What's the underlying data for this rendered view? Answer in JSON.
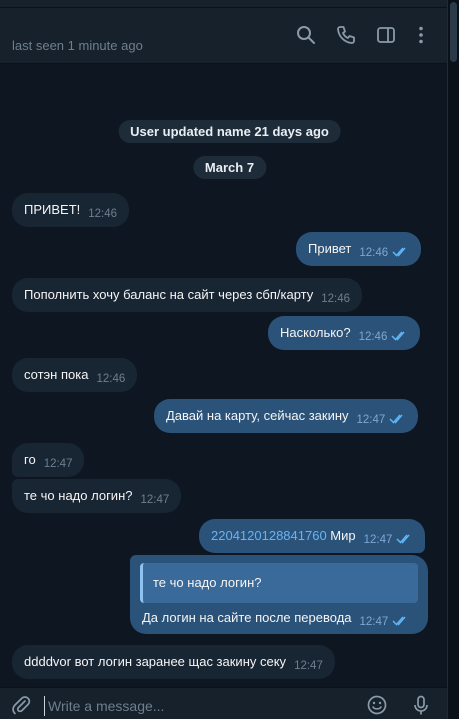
{
  "header": {
    "status": "last seen 1 minute ago",
    "icons": [
      "search-icon",
      "phone-icon",
      "sidebar-icon",
      "more-icon"
    ]
  },
  "service": {
    "name_update": "User updated name 21 days ago",
    "date": "March 7"
  },
  "messages": [
    {
      "dir": "in",
      "text": "ПРИВЕТ!",
      "time": "12:46"
    },
    {
      "dir": "out",
      "text": "Привет",
      "time": "12:46"
    },
    {
      "dir": "in",
      "text": "Пополнить хочу баланс на сайт через сбп/карту",
      "time": "12:46"
    },
    {
      "dir": "out",
      "text": "Насколько?",
      "time": "12:46"
    },
    {
      "dir": "in",
      "text": "сотэн пока",
      "time": "12:46"
    },
    {
      "dir": "out",
      "text": "Давай на карту, сейчас закину",
      "time": "12:47"
    },
    {
      "dir": "in",
      "text": "го",
      "time": "12:47"
    },
    {
      "dir": "in",
      "text": "те чо надо логин?",
      "time": "12:47"
    },
    {
      "dir": "out",
      "link": "2204120128841760",
      "text": " Мир",
      "time": "12:47"
    },
    {
      "dir": "out",
      "quote": "те чо надо логин?",
      "text": "Да логин на сайте после перевода",
      "time": "12:47"
    },
    {
      "dir": "in",
      "text": "ddddvor вот логин заранее щас закину секу",
      "time": "12:47"
    }
  ],
  "composer": {
    "placeholder": "Write a message...",
    "icons": [
      "attach-icon",
      "emoji-icon",
      "microphone-icon"
    ]
  },
  "colors": {
    "background": "#0e1621",
    "incoming_bubble": "#182533",
    "outgoing_bubble": "#2b5278",
    "link": "#6ab3f3",
    "meta": "#6d7f8f"
  }
}
